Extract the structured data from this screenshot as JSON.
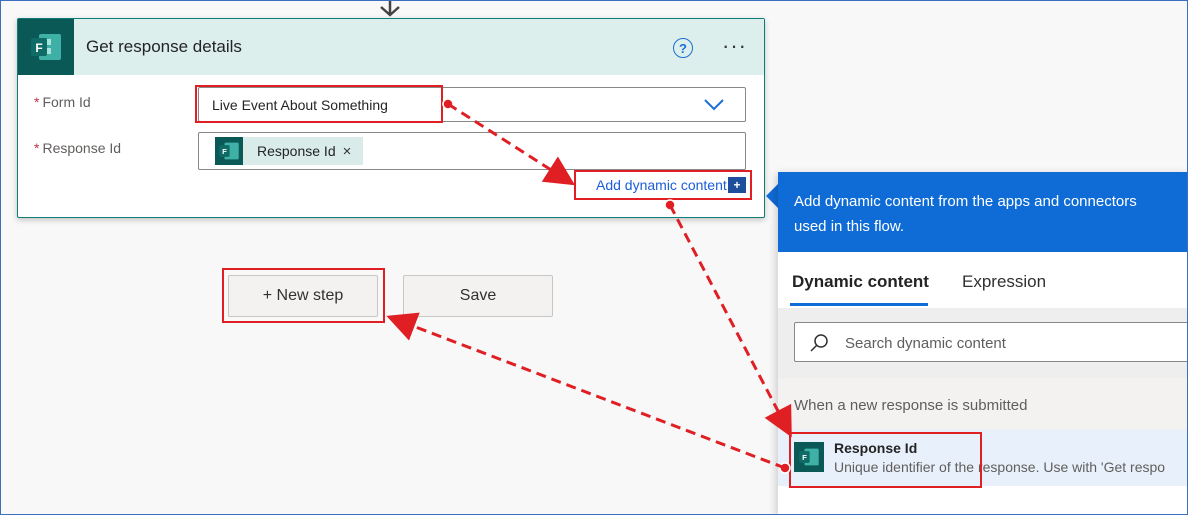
{
  "card": {
    "title": "Get response details",
    "help_glyph": "?",
    "more_glyph": "···",
    "icon": "forms-icon"
  },
  "fields": {
    "form_id": {
      "required_mark": "*",
      "label": "Form Id",
      "value": "Live Event About Something"
    },
    "response_id": {
      "required_mark": "*",
      "label": "Response Id",
      "token_label": "Response Id",
      "token_remove": "×"
    }
  },
  "add_dynamic_content": {
    "label": "Add dynamic content",
    "icon_glyph": "+"
  },
  "actions": {
    "new_step": "+ New step",
    "save": "Save"
  },
  "dynamic_panel": {
    "header": "Add dynamic content from the apps and connectors used in this flow.",
    "tabs": [
      {
        "label": "Dynamic content",
        "active": true
      },
      {
        "label": "Expression",
        "active": false
      }
    ],
    "search_placeholder": "Search dynamic content",
    "section_title": "When a new response is submitted",
    "items": [
      {
        "title": "Response Id",
        "description": "Unique identifier of the response. Use with 'Get respo"
      }
    ]
  },
  "colors": {
    "card_header_bg": "#dcefed",
    "forms_icon_bg": "#0b5956",
    "panel_accent": "#0f6cd6",
    "annotation_red": "#e01f24"
  }
}
